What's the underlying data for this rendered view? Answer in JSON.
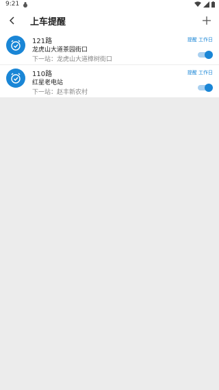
{
  "status_bar": {
    "time": "9:21"
  },
  "header": {
    "title": "上车提醒"
  },
  "reminders": [
    {
      "route": "121路",
      "stop": "龙虎山大道茶园街口",
      "next_stop": "下一站：龙虎山大道樟树街口",
      "tag": "提醒 工作日",
      "enabled": true
    },
    {
      "route": "110路",
      "stop": "红星老电站",
      "next_stop": "下一站：赵丰新农村",
      "tag": "提醒 工作日",
      "enabled": true
    }
  ],
  "colors": {
    "accent": "#1a86d6",
    "background": "#ececec"
  }
}
